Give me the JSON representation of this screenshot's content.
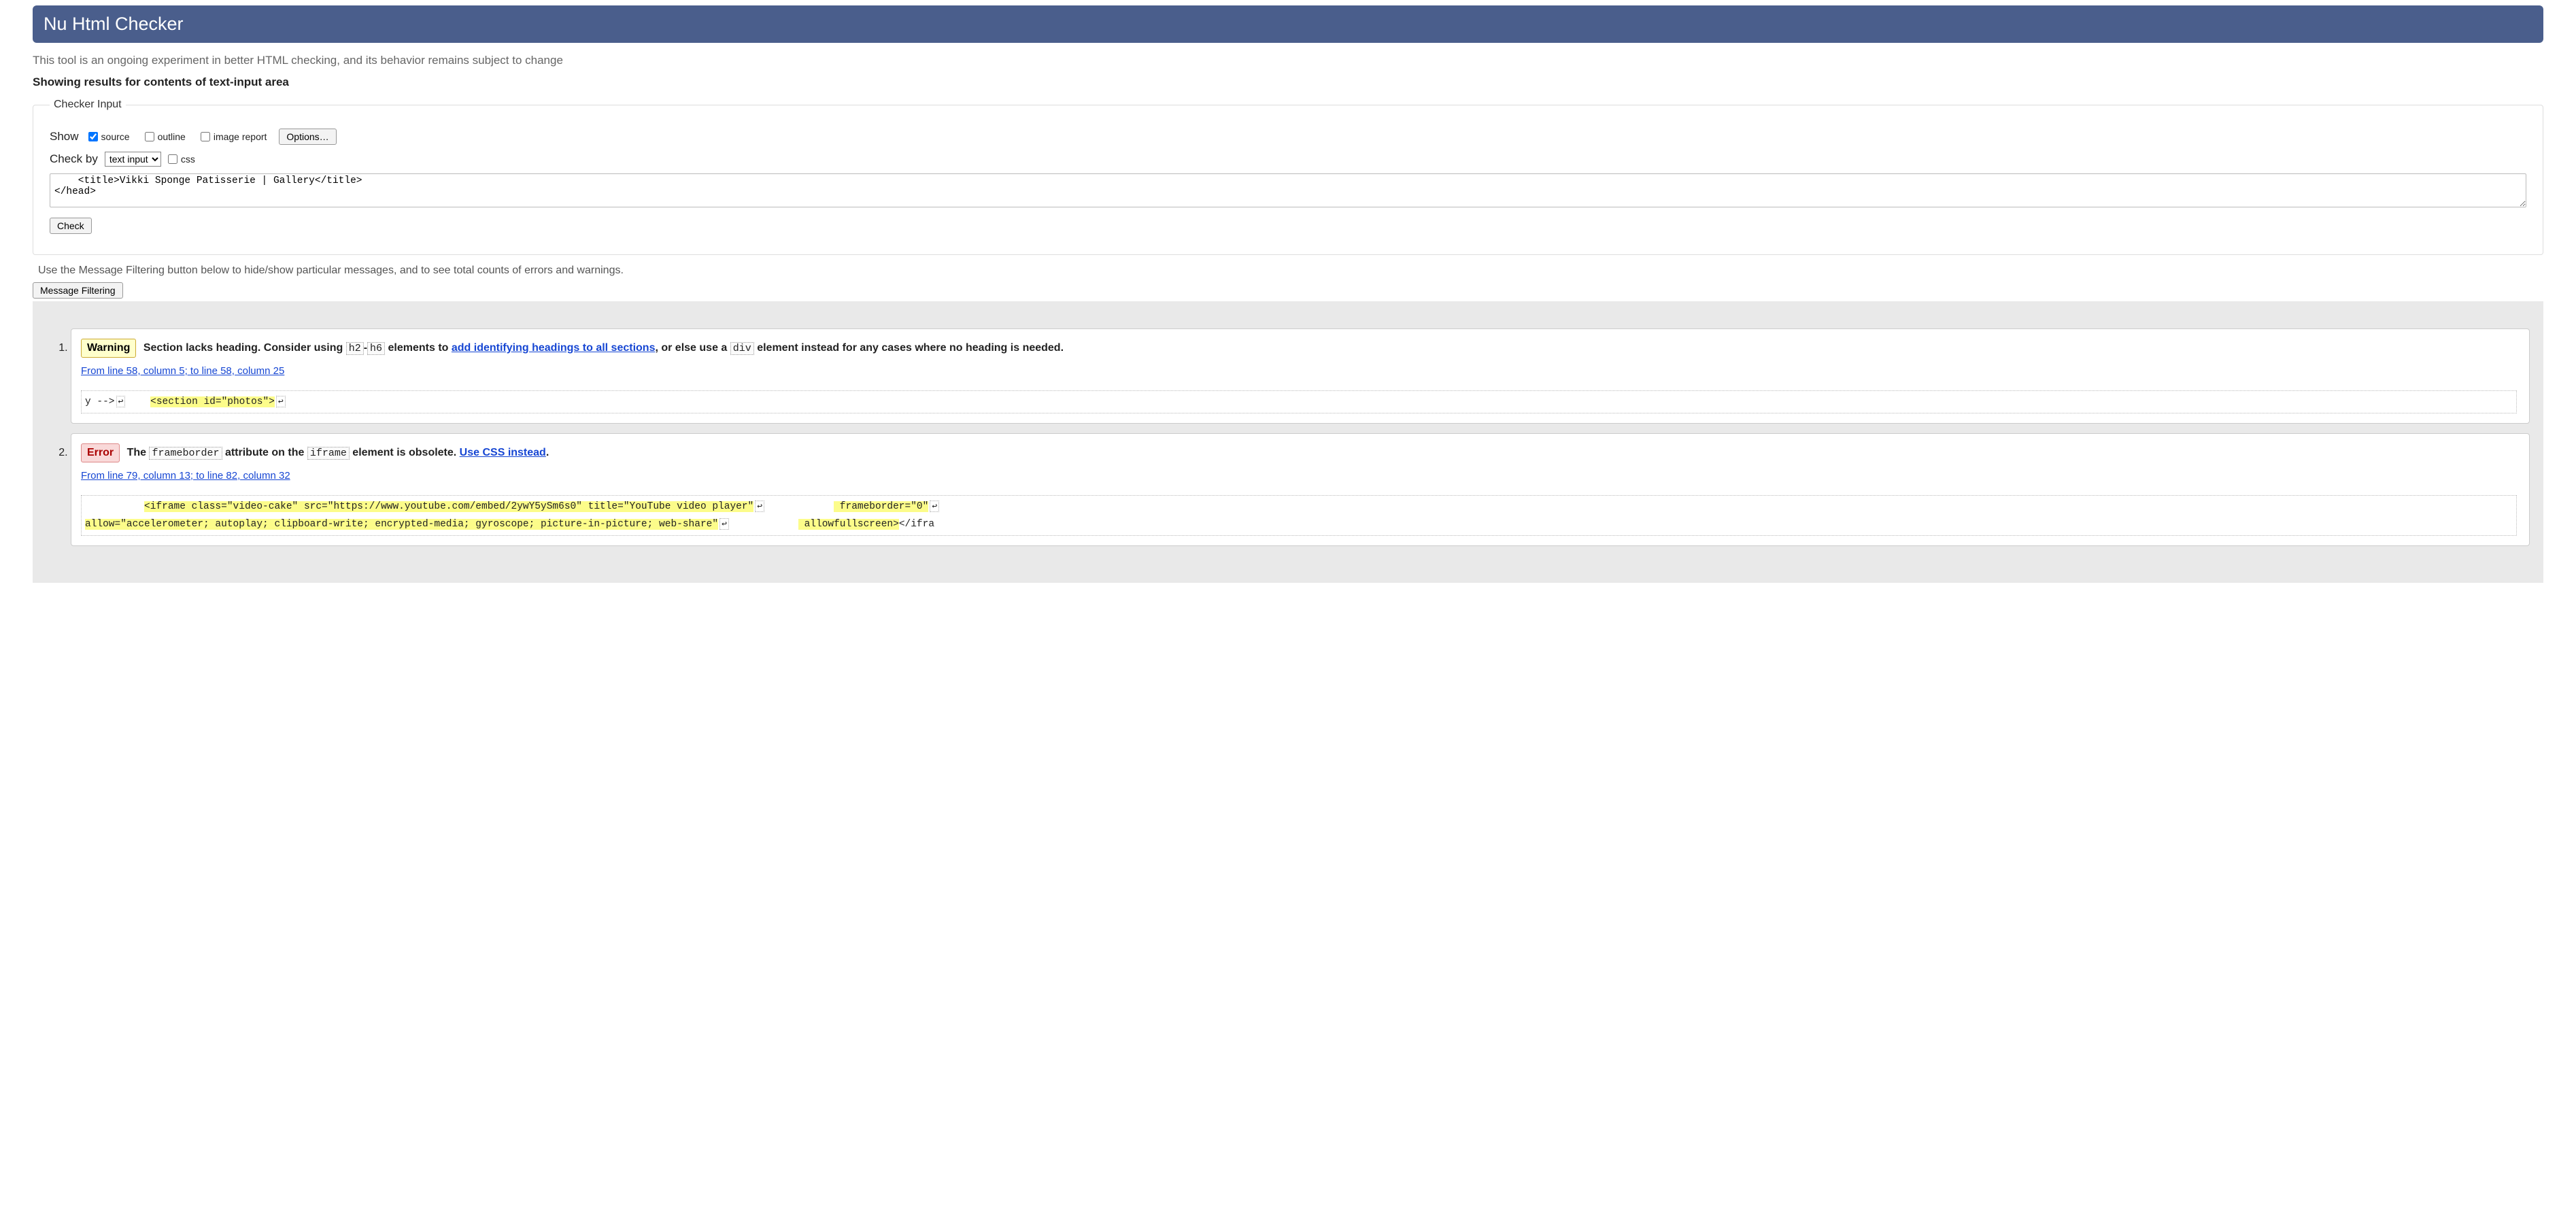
{
  "header": {
    "title": "Nu Html Checker"
  },
  "subtitle": "This tool is an ongoing experiment in better HTML checking, and its behavior remains subject to change",
  "results_heading": "Showing results for contents of text-input area",
  "checker": {
    "legend": "Checker Input",
    "show_label": "Show",
    "source_label": "source",
    "outline_label": "outline",
    "image_report_label": "image report",
    "options_button": "Options…",
    "check_by_label": "Check by",
    "check_by_value": "text input",
    "css_label": "css",
    "textarea_value": "    <title>Vikki Sponge Patisserie | Gallery</title>\n</head>",
    "check_button": "Check"
  },
  "filter": {
    "hint": "Use the Message Filtering button below to hide/show particular messages, and to see total counts of errors and warnings.",
    "button": "Message Filtering"
  },
  "messages": [
    {
      "type": "Warning",
      "text_prefix": "Section lacks heading. Consider using ",
      "code1": "h2",
      "dash": "-",
      "code2": "h6",
      "text_mid": " elements to ",
      "link": "add identifying headings to all sections",
      "text_after_link": ", or else use a ",
      "code3": "div",
      "text_suffix": " element instead for any cases where no heading is needed.",
      "location": "From line 58, column 5; to line 58, column 25",
      "extract_pre": "y -->",
      "nl1": "↩",
      "extract_gap": "    ",
      "extract_hl": "<section id=\"photos\">",
      "nl2": "↩"
    },
    {
      "type": "Error",
      "text_prefix": "The ",
      "code1": "frameborder",
      "text_mid1": " attribute on the ",
      "code2": "iframe",
      "text_mid2": " element is obsolete. ",
      "link": "Use CSS instead",
      "text_suffix": ".",
      "location": "From line 79, column 13; to line 82, column 32",
      "extract_line1_pre": "          ",
      "extract_line1_hl": "<iframe class=\"video-cake\" src=\"https://www.youtube.com/embed/2ywY5ySm6s0\" title=\"YouTube video player\"",
      "nl1": "↩",
      "extract_line1_hl2": "            frameborder=\"0\"",
      "nl2": "↩",
      "extract_line2_hl": "allow=\"accelerometer; autoplay; clipboard-write; encrypted-media; gyroscope; picture-in-picture; web-share\"",
      "nl3": "↩",
      "extract_line2_hl2": "            allowfullscreen>",
      "extract_post": "</ifra"
    }
  ]
}
